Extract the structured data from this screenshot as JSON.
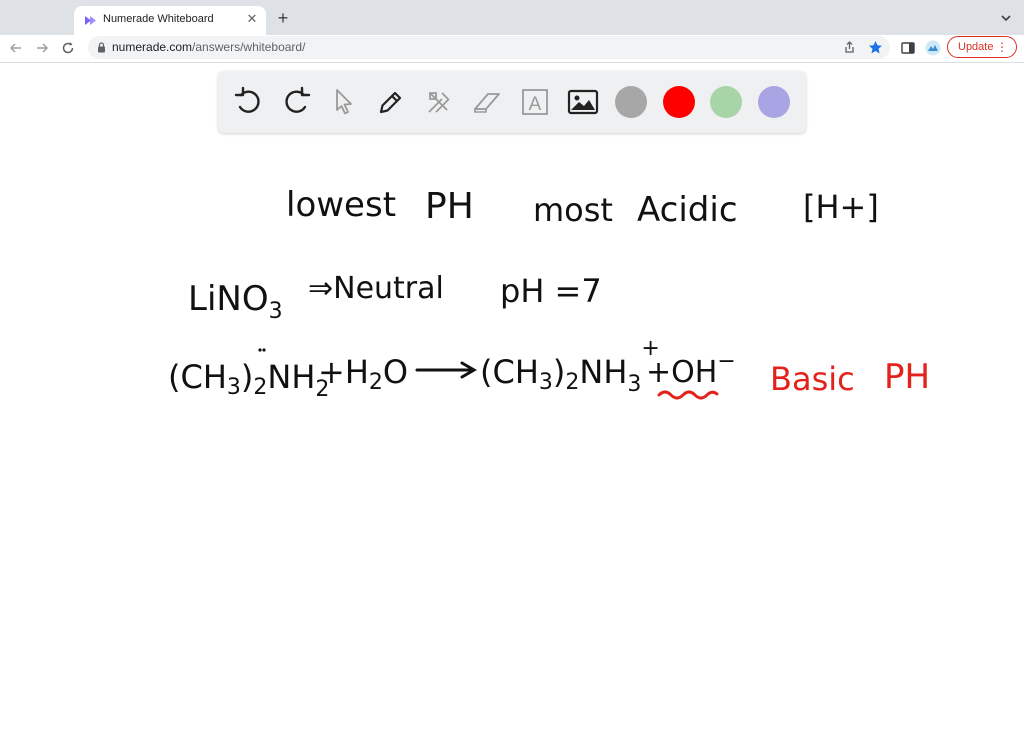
{
  "browser": {
    "tab_title": "Numerade Whiteboard",
    "new_tab_label": "+",
    "url_host": "numerade.com",
    "url_path": "/answers/whiteboard/",
    "update_label": "Update",
    "menu_label": "⋮"
  },
  "palette": {
    "tools": [
      {
        "name": "undo-icon"
      },
      {
        "name": "redo-icon"
      },
      {
        "name": "select-cursor-icon"
      },
      {
        "name": "pen-icon"
      },
      {
        "name": "tools-icon"
      },
      {
        "name": "eraser-icon"
      },
      {
        "name": "text-tool-icon",
        "label": "A"
      },
      {
        "name": "image-icon"
      }
    ],
    "colors": [
      "#a7a7a7",
      "#ff0000",
      "#a8d5a8",
      "#a9a5e4"
    ]
  },
  "whiteboard": {
    "line1": {
      "a": "lowest",
      "b": "PH",
      "c": "most",
      "d": "Acidic",
      "e": "[H+]"
    },
    "line2": {
      "compound": "LiNO",
      "compound_sub": "3",
      "arrow_text": "⇒Neutral",
      "ph": "pH =7"
    },
    "line3": {
      "reactant1": "(CH",
      "reactant1_sub1": "3",
      "reactant1_mid": ")",
      "reactant1_sub2": "2",
      "reactant1_tail": "NH",
      "reactant1_sub3": "2",
      "plus_water": "+H",
      "water_sub": "2",
      "water_tail": "O",
      "product": "(CH",
      "product_sub1": "3",
      "product_mid": ")",
      "product_sub2": "2",
      "product_tail": "NH",
      "product_sub3": "3",
      "product_charge": "+",
      "hydroxide": "+OH",
      "hydroxide_charge": "−",
      "basic": "Basic",
      "basic_ph": "PH"
    },
    "ink_color": "#111111",
    "accent_color": "#e3221b"
  }
}
